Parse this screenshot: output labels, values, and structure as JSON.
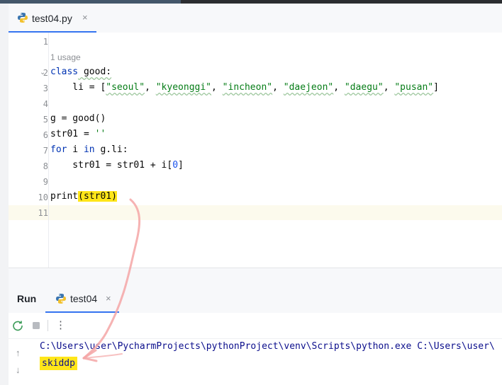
{
  "editor_tab": {
    "filename": "test04.py",
    "close": "×"
  },
  "editor": {
    "usage_hint": "1 usage",
    "line_numbers": [
      "1",
      "2",
      "3",
      "4",
      "5",
      "6",
      "7",
      "8",
      "9",
      "10",
      "11"
    ],
    "lines": {
      "l2_kw": "class",
      "l2_rest": " good:",
      "l3_indent": "    li = [",
      "l3_s1": "\"seoul\"",
      "l3_s2": "\"kyeonggi\"",
      "l3_s3": "\"incheon\"",
      "l3_s4": "\"daejeon\"",
      "l3_s5": "\"daegu\"",
      "l3_s6": "\"pusan\"",
      "l5": "g = good()",
      "l6_a": "str01 = ",
      "l6_b": "''",
      "l7_kw1": "for",
      "l7_mid": " i ",
      "l7_kw2": "in",
      "l7_end": " g.li:",
      "l8_a": "    str01 = str01 + i[",
      "l8_num": "0",
      "l8_b": "]",
      "l10_a": "print",
      "l10_b": "(str01)"
    }
  },
  "run_panel": {
    "title": "Run",
    "tab_label": "test04",
    "close": "×",
    "rerun_icon": "rerun-icon",
    "stop_icon": "stop-icon",
    "more_label": "⋮"
  },
  "console": {
    "command": "C:\\Users\\user\\PycharmProjects\\pythonProject\\venv\\Scripts\\python.exe C:\\Users\\user\\",
    "output": "skiddp",
    "up": "↑",
    "down": "↓"
  },
  "colors": {
    "keyword": "#0033b3",
    "string": "#067d17",
    "highlight": "#ffe619",
    "accent": "#3574f0",
    "annotation_arrow": "#f2a3a3"
  }
}
